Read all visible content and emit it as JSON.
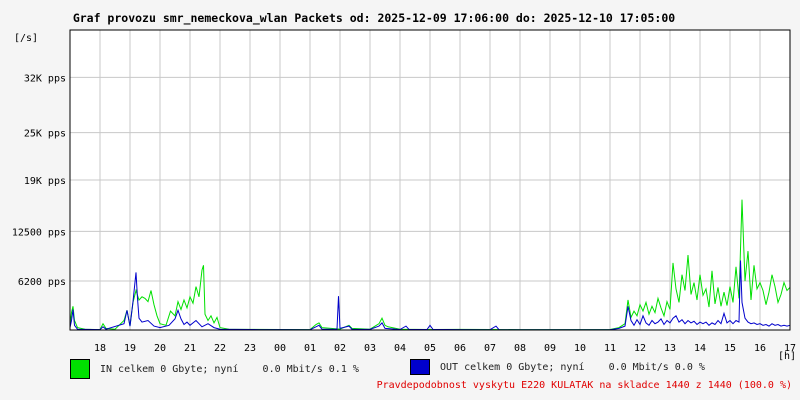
{
  "chart_data": {
    "type": "line",
    "title": "Graf provozu smr_nemeckova_wlan Packets od: 2025-12-09 17:06:00 do: 2025-12-10 17:05:00",
    "ylabel": "[/s]",
    "xlabel": "[h]",
    "ylim": [
      0,
      38000
    ],
    "y_ticks": [
      {
        "value": 6200,
        "label": "6200 pps"
      },
      {
        "value": 12500,
        "label": "12500 pps"
      },
      {
        "value": 19000,
        "label": "19K pps"
      },
      {
        "value": 25000,
        "label": "25K pps"
      },
      {
        "value": 32000,
        "label": "32K pps"
      }
    ],
    "x_ticks": [
      "18",
      "19",
      "20",
      "21",
      "22",
      "23",
      "00",
      "01",
      "02",
      "03",
      "04",
      "05",
      "06",
      "07",
      "08",
      "09",
      "10",
      "11",
      "12",
      "13",
      "14",
      "15",
      "16",
      "17"
    ],
    "grid": true,
    "series": [
      {
        "name": "IN",
        "color": "#00e000",
        "points": [
          [
            0.0,
            500
          ],
          [
            0.05,
            2200
          ],
          [
            0.1,
            3000
          ],
          [
            0.15,
            1200
          ],
          [
            0.25,
            300
          ],
          [
            0.5,
            100
          ],
          [
            1.0,
            50
          ],
          [
            1.1,
            800
          ],
          [
            1.2,
            200
          ],
          [
            1.5,
            100
          ],
          [
            1.8,
            1200
          ],
          [
            1.9,
            2500
          ],
          [
            2.0,
            500
          ],
          [
            2.1,
            3500
          ],
          [
            2.2,
            5000
          ],
          [
            2.3,
            3800
          ],
          [
            2.4,
            4200
          ],
          [
            2.5,
            4000
          ],
          [
            2.6,
            3600
          ],
          [
            2.7,
            5000
          ],
          [
            2.8,
            3200
          ],
          [
            2.9,
            1800
          ],
          [
            3.0,
            800
          ],
          [
            3.2,
            600
          ],
          [
            3.35,
            2400
          ],
          [
            3.5,
            1800
          ],
          [
            3.6,
            3600
          ],
          [
            3.7,
            2600
          ],
          [
            3.8,
            3800
          ],
          [
            3.9,
            2800
          ],
          [
            4.0,
            4200
          ],
          [
            4.1,
            3400
          ],
          [
            4.2,
            5500
          ],
          [
            4.3,
            4200
          ],
          [
            4.4,
            7600
          ],
          [
            4.45,
            8200
          ],
          [
            4.5,
            2000
          ],
          [
            4.6,
            1200
          ],
          [
            4.7,
            1800
          ],
          [
            4.8,
            900
          ],
          [
            4.9,
            1600
          ],
          [
            5.0,
            300
          ],
          [
            5.3,
            100
          ],
          [
            6.0,
            80
          ],
          [
            7.0,
            60
          ],
          [
            8.0,
            50
          ],
          [
            8.2,
            700
          ],
          [
            8.3,
            900
          ],
          [
            8.4,
            300
          ],
          [
            9.0,
            120
          ],
          [
            9.3,
            600
          ],
          [
            9.4,
            200
          ],
          [
            10.0,
            100
          ],
          [
            10.3,
            800
          ],
          [
            10.4,
            1500
          ],
          [
            10.5,
            600
          ],
          [
            10.6,
            400
          ],
          [
            11.0,
            100
          ],
          [
            12.0,
            60
          ],
          [
            13.0,
            80
          ],
          [
            14.0,
            60
          ],
          [
            15.0,
            50
          ],
          [
            16.0,
            50
          ],
          [
            17.0,
            50
          ],
          [
            18.0,
            60
          ],
          [
            18.3,
            300
          ],
          [
            18.5,
            800
          ],
          [
            18.6,
            3800
          ],
          [
            18.7,
            1600
          ],
          [
            18.8,
            2400
          ],
          [
            18.9,
            1800
          ],
          [
            19.0,
            3200
          ],
          [
            19.1,
            2400
          ],
          [
            19.2,
            3500
          ],
          [
            19.3,
            2000
          ],
          [
            19.4,
            3000
          ],
          [
            19.5,
            2200
          ],
          [
            19.6,
            4000
          ],
          [
            19.7,
            2800
          ],
          [
            19.8,
            1800
          ],
          [
            19.9,
            3600
          ],
          [
            20.0,
            2600
          ],
          [
            20.1,
            8500
          ],
          [
            20.2,
            5200
          ],
          [
            20.3,
            3500
          ],
          [
            20.4,
            7000
          ],
          [
            20.5,
            5000
          ],
          [
            20.6,
            9500
          ],
          [
            20.7,
            4500
          ],
          [
            20.8,
            6000
          ],
          [
            20.9,
            3800
          ],
          [
            21.0,
            7000
          ],
          [
            21.1,
            4400
          ],
          [
            21.2,
            5200
          ],
          [
            21.3,
            2900
          ],
          [
            21.4,
            7500
          ],
          [
            21.5,
            3300
          ],
          [
            21.6,
            5400
          ],
          [
            21.7,
            3000
          ],
          [
            21.8,
            4800
          ],
          [
            21.9,
            3100
          ],
          [
            22.0,
            5500
          ],
          [
            22.1,
            3500
          ],
          [
            22.2,
            8000
          ],
          [
            22.3,
            4000
          ],
          [
            22.4,
            16500
          ],
          [
            22.5,
            6200
          ],
          [
            22.6,
            10000
          ],
          [
            22.7,
            3800
          ],
          [
            22.8,
            8200
          ],
          [
            22.9,
            5200
          ],
          [
            23.0,
            6000
          ],
          [
            23.1,
            5000
          ],
          [
            23.2,
            3200
          ],
          [
            23.3,
            4800
          ],
          [
            23.4,
            7000
          ],
          [
            23.5,
            5500
          ],
          [
            23.6,
            3500
          ],
          [
            23.7,
            4500
          ],
          [
            23.8,
            6000
          ],
          [
            23.9,
            5000
          ],
          [
            24.0,
            5400
          ]
        ]
      },
      {
        "name": "OUT",
        "color": "#0000cc",
        "points": [
          [
            0.0,
            300
          ],
          [
            0.05,
            1200
          ],
          [
            0.1,
            2600
          ],
          [
            0.15,
            600
          ],
          [
            0.25,
            100
          ],
          [
            1.0,
            50
          ],
          [
            1.1,
            400
          ],
          [
            1.2,
            100
          ],
          [
            1.8,
            800
          ],
          [
            1.9,
            2500
          ],
          [
            2.0,
            500
          ],
          [
            2.1,
            3600
          ],
          [
            2.2,
            7300
          ],
          [
            2.25,
            4000
          ],
          [
            2.3,
            1500
          ],
          [
            2.4,
            1000
          ],
          [
            2.6,
            1200
          ],
          [
            2.8,
            500
          ],
          [
            3.0,
            300
          ],
          [
            3.3,
            600
          ],
          [
            3.5,
            1400
          ],
          [
            3.6,
            2500
          ],
          [
            3.7,
            1400
          ],
          [
            3.8,
            700
          ],
          [
            3.9,
            1000
          ],
          [
            4.0,
            600
          ],
          [
            4.2,
            1200
          ],
          [
            4.4,
            400
          ],
          [
            4.6,
            800
          ],
          [
            4.8,
            300
          ],
          [
            5.0,
            100
          ],
          [
            6.0,
            60
          ],
          [
            6.3,
            50
          ],
          [
            7.0,
            50
          ],
          [
            8.0,
            40
          ],
          [
            8.2,
            400
          ],
          [
            8.3,
            600
          ],
          [
            8.4,
            100
          ],
          [
            8.9,
            100
          ],
          [
            8.95,
            4300
          ],
          [
            9.0,
            200
          ],
          [
            9.3,
            500
          ],
          [
            9.4,
            100
          ],
          [
            10.0,
            80
          ],
          [
            10.3,
            500
          ],
          [
            10.4,
            900
          ],
          [
            10.5,
            200
          ],
          [
            11.0,
            60
          ],
          [
            11.2,
            500
          ],
          [
            11.3,
            80
          ],
          [
            11.9,
            60
          ],
          [
            12.0,
            600
          ],
          [
            12.1,
            80
          ],
          [
            13.0,
            50
          ],
          [
            14.0,
            40
          ],
          [
            14.2,
            500
          ],
          [
            14.3,
            40
          ],
          [
            15.0,
            40
          ],
          [
            16.0,
            40
          ],
          [
            17.0,
            40
          ],
          [
            18.0,
            40
          ],
          [
            18.3,
            200
          ],
          [
            18.5,
            500
          ],
          [
            18.6,
            3000
          ],
          [
            18.7,
            1200
          ],
          [
            18.8,
            600
          ],
          [
            18.9,
            1300
          ],
          [
            19.0,
            700
          ],
          [
            19.1,
            1800
          ],
          [
            19.2,
            900
          ],
          [
            19.3,
            600
          ],
          [
            19.4,
            1200
          ],
          [
            19.5,
            800
          ],
          [
            19.6,
            1000
          ],
          [
            19.7,
            1400
          ],
          [
            19.8,
            700
          ],
          [
            19.9,
            1200
          ],
          [
            20.0,
            900
          ],
          [
            20.1,
            1500
          ],
          [
            20.2,
            1800
          ],
          [
            20.3,
            1000
          ],
          [
            20.4,
            1300
          ],
          [
            20.5,
            800
          ],
          [
            20.6,
            1200
          ],
          [
            20.7,
            900
          ],
          [
            20.8,
            1100
          ],
          [
            20.9,
            700
          ],
          [
            21.0,
            1000
          ],
          [
            21.1,
            800
          ],
          [
            21.2,
            1000
          ],
          [
            21.3,
            600
          ],
          [
            21.4,
            900
          ],
          [
            21.5,
            700
          ],
          [
            21.6,
            1200
          ],
          [
            21.7,
            800
          ],
          [
            21.8,
            2100
          ],
          [
            21.9,
            900
          ],
          [
            22.0,
            1200
          ],
          [
            22.1,
            800
          ],
          [
            22.2,
            1200
          ],
          [
            22.3,
            1000
          ],
          [
            22.35,
            8800
          ],
          [
            22.4,
            3500
          ],
          [
            22.5,
            1500
          ],
          [
            22.6,
            1000
          ],
          [
            22.7,
            800
          ],
          [
            22.8,
            900
          ],
          [
            22.9,
            700
          ],
          [
            23.0,
            800
          ],
          [
            23.1,
            600
          ],
          [
            23.2,
            700
          ],
          [
            23.3,
            500
          ],
          [
            23.4,
            800
          ],
          [
            23.5,
            600
          ],
          [
            23.6,
            700
          ],
          [
            23.7,
            500
          ],
          [
            23.8,
            600
          ],
          [
            23.9,
            500
          ],
          [
            24.0,
            600
          ]
        ]
      }
    ]
  },
  "legend": {
    "in_text": "IN celkem 0 Gbyte; nyní    0.0 Mbit/s 0.1 %",
    "out_text": "OUT celkem 0 Gbyte; nyní    0.0 Mbit/s 0.0 %",
    "in_color": "#00e000",
    "out_color": "#0000cc"
  },
  "footer": {
    "note": "Pravdepodobnost vyskytu E220 KULATAK na skladce 1440 z 1440 (100.0 %)",
    "color": "#e00000"
  }
}
